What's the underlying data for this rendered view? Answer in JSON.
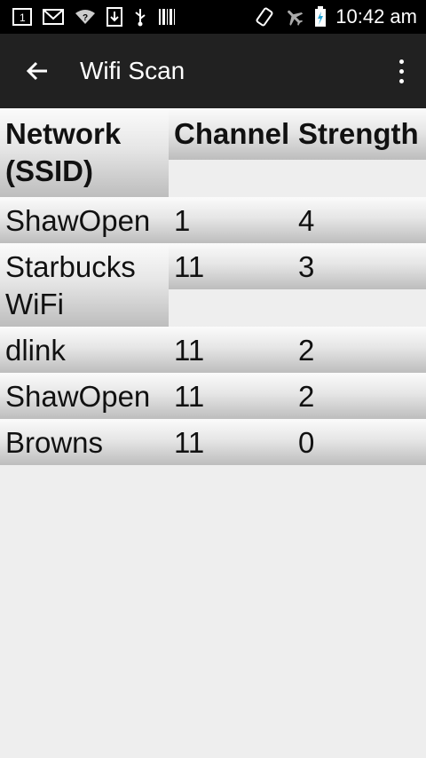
{
  "status_bar": {
    "time": "10:42 am",
    "left_icons": [
      "sim-slot-icon",
      "gmail-icon",
      "wifi-question-icon",
      "download-icon",
      "usb-icon",
      "barcode-icon"
    ],
    "right_icons": [
      "rotate-icon",
      "airplane-icon",
      "battery-charging-icon"
    ]
  },
  "action_bar": {
    "title": "Wifi Scan",
    "back_icon": "arrow-left-icon",
    "menu_icon": "overflow-menu-icon"
  },
  "table": {
    "headers": [
      "Network (SSID)",
      "Channel",
      "Strength"
    ],
    "rows": [
      {
        "ssid": "ShawOpen",
        "channel": "1",
        "strength": "4"
      },
      {
        "ssid": "Starbucks WiFi",
        "channel": "11",
        "strength": "3"
      },
      {
        "ssid": "dlink",
        "channel": "11",
        "strength": "2"
      },
      {
        "ssid": "ShawOpen",
        "channel": "11",
        "strength": "2"
      },
      {
        "ssid": "Browns",
        "channel": "11",
        "strength": "0"
      }
    ]
  }
}
